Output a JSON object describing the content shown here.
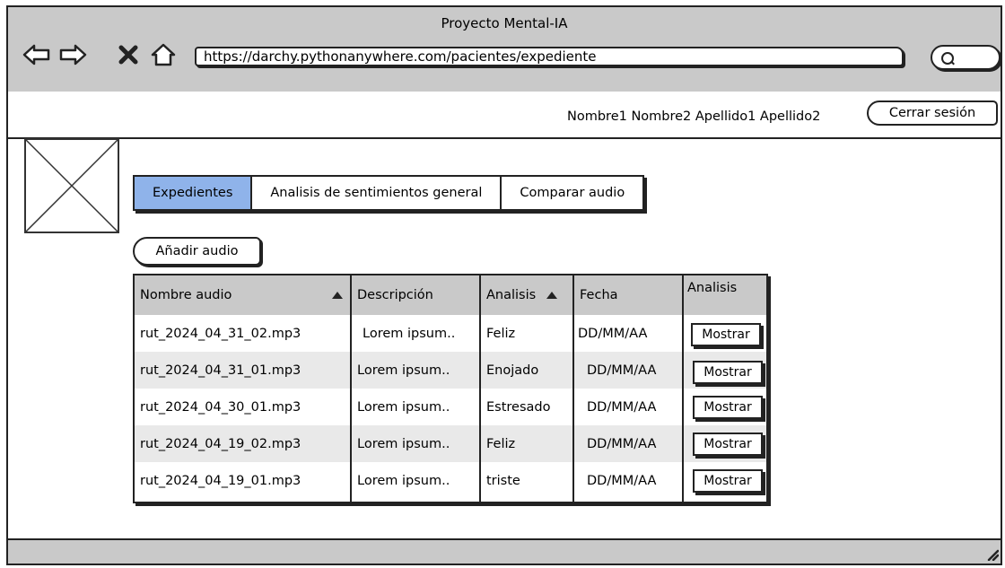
{
  "window": {
    "title": "Proyecto Mental-IA"
  },
  "browser": {
    "url": "https://darchy.pythonanywhere.com/pacientes/expediente",
    "icons": [
      "back-arrow-icon",
      "forward-arrow-icon",
      "close-x-icon",
      "home-icon",
      "search-icon"
    ]
  },
  "header": {
    "user_name": "Nombre1 Nombre2 Apellido1 Apellido2",
    "logout_label": "Cerrar sesión"
  },
  "tabs": [
    {
      "label": "Expedientes",
      "active": true
    },
    {
      "label": "Analisis de sentimientos general",
      "active": false
    },
    {
      "label": "Comparar audio",
      "active": false
    }
  ],
  "actions": {
    "add_audio_label": "Añadir audio"
  },
  "table": {
    "columns": [
      "Nombre audio",
      "Descripción",
      "Analisis",
      "Fecha",
      "Analisis"
    ],
    "rows": [
      {
        "name": "rut_2024_04_31_02.mp3",
        "description": "Lorem ipsum..",
        "analysis": "Feliz",
        "date": "DD/MM/AA",
        "action": "Mostrar"
      },
      {
        "name": "rut_2024_04_31_01.mp3",
        "description": "Lorem ipsum..",
        "analysis": "Enojado",
        "date": "DD/MM/AA",
        "action": "Mostrar"
      },
      {
        "name": "rut_2024_04_30_01.mp3",
        "description": "Lorem ipsum..",
        "analysis": "Estresado",
        "date": "DD/MM/AA",
        "action": "Mostrar"
      },
      {
        "name": "rut_2024_04_19_02.mp3",
        "description": "Lorem ipsum..",
        "analysis": "Feliz",
        "date": "DD/MM/AA",
        "action": "Mostrar"
      },
      {
        "name": "rut_2024_04_19_01.mp3",
        "description": "Lorem ipsum..",
        "analysis": "triste",
        "date": "DD/MM/AA",
        "action": "Mostrar"
      }
    ]
  },
  "colors": {
    "active_tab": "#8fb3ea",
    "chrome": "#c9c9c9",
    "alt_row": "#e9e9e9"
  }
}
